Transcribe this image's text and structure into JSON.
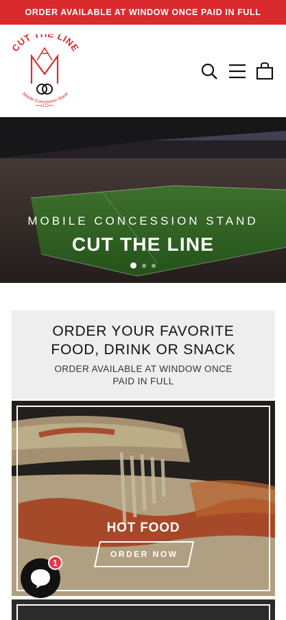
{
  "announcement": {
    "text": "ORDER AVAILABLE AT WINDOW ONCE PAID IN FULL"
  },
  "brand": {
    "logo_text": "CUT THE LINE",
    "logo_tagline": "Mobile Concession Stand",
    "logo_llc": "LLC",
    "accent_color": "#d92a2d"
  },
  "header": {
    "icons": [
      "search-icon",
      "menu-icon",
      "cart-icon"
    ]
  },
  "hero": {
    "subtitle": "MOBILE CONCESSION STAND",
    "title": "CUT THE LINE",
    "slides": 3,
    "active_slide": 1
  },
  "order_section": {
    "title_line1": "ORDER YOUR FAVORITE",
    "title_line2": "FOOD, DRINK OR SNACK",
    "subtitle_line1": "ORDER AVAILABLE AT WINDOW ONCE",
    "subtitle_line2": "PAID IN FULL"
  },
  "cards": [
    {
      "title": "HOT FOOD",
      "button_label": "ORDER NOW"
    }
  ],
  "chat": {
    "badge_count": "1"
  }
}
